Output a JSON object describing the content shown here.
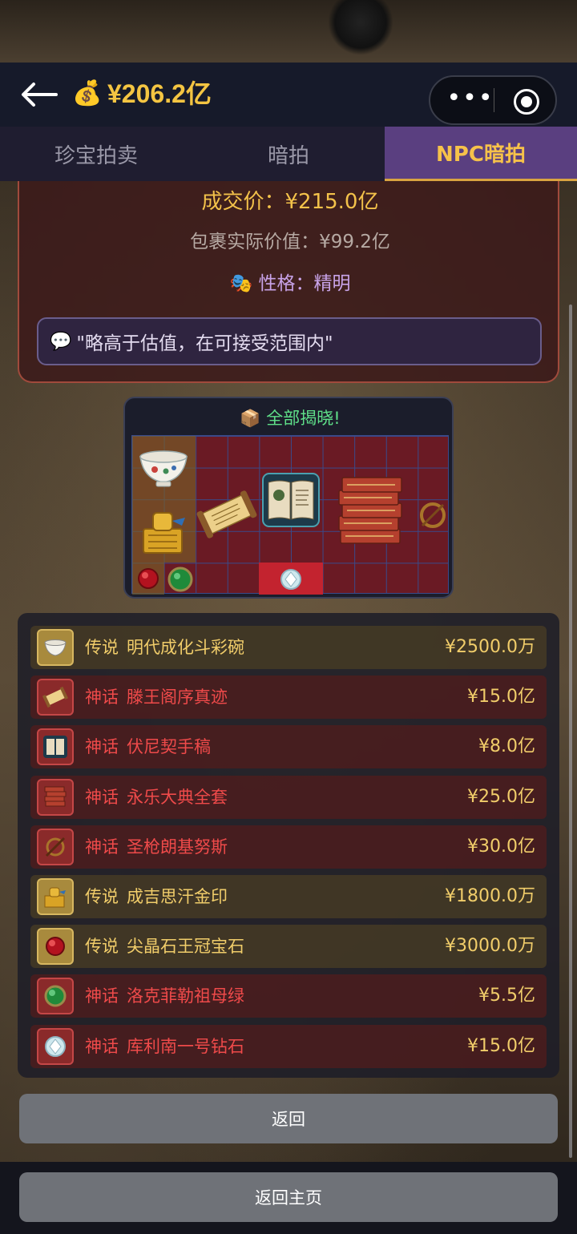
{
  "header": {
    "balance": "¥206.2亿"
  },
  "tabs": [
    {
      "label": "珍宝拍卖",
      "active": false
    },
    {
      "label": "暗拍",
      "active": false
    },
    {
      "label": "NPC暗拍",
      "active": true
    }
  ],
  "result": {
    "deal_price": "成交价：¥215.0亿",
    "actual_value": "包裹实际价值：¥99.2亿",
    "personality": "性格：精明",
    "quote": "\"略高于估值，在可接受范围内\""
  },
  "reveal": {
    "title": "全部揭晓!"
  },
  "items": [
    {
      "rarity": "传说",
      "name": "明代成化斗彩碗",
      "price": "¥2500.0万",
      "tier": "legend",
      "icon": "bowl-icon"
    },
    {
      "rarity": "神话",
      "name": "滕王阁序真迹",
      "price": "¥15.0亿",
      "tier": "myth",
      "icon": "scroll-icon"
    },
    {
      "rarity": "神话",
      "name": "伏尼契手稿",
      "price": "¥8.0亿",
      "tier": "myth",
      "icon": "manuscript-icon"
    },
    {
      "rarity": "神话",
      "name": "永乐大典全套",
      "price": "¥25.0亿",
      "tier": "myth",
      "icon": "books-icon"
    },
    {
      "rarity": "神话",
      "name": "圣枪朗基努斯",
      "price": "¥30.0亿",
      "tier": "myth",
      "icon": "spear-icon"
    },
    {
      "rarity": "传说",
      "name": "成吉思汗金印",
      "price": "¥1800.0万",
      "tier": "legend",
      "icon": "seal-icon"
    },
    {
      "rarity": "传说",
      "name": "尖晶石王冠宝石",
      "price": "¥3000.0万",
      "tier": "legend",
      "icon": "ruby-icon"
    },
    {
      "rarity": "神话",
      "name": "洛克菲勒祖母绿",
      "price": "¥5.5亿",
      "tier": "myth",
      "icon": "emerald-icon"
    },
    {
      "rarity": "神话",
      "name": "库利南一号钻石",
      "price": "¥15.0亿",
      "tier": "myth",
      "icon": "diamond-icon"
    }
  ],
  "buttons": {
    "back": "返回",
    "home": "返回主页"
  },
  "colors": {
    "gold": "#f3c24a",
    "myth_red": "#ef4a4a",
    "tab_active": "#5a3f80",
    "personality": "#c8a3e8",
    "reveal_green": "#5fe089"
  }
}
